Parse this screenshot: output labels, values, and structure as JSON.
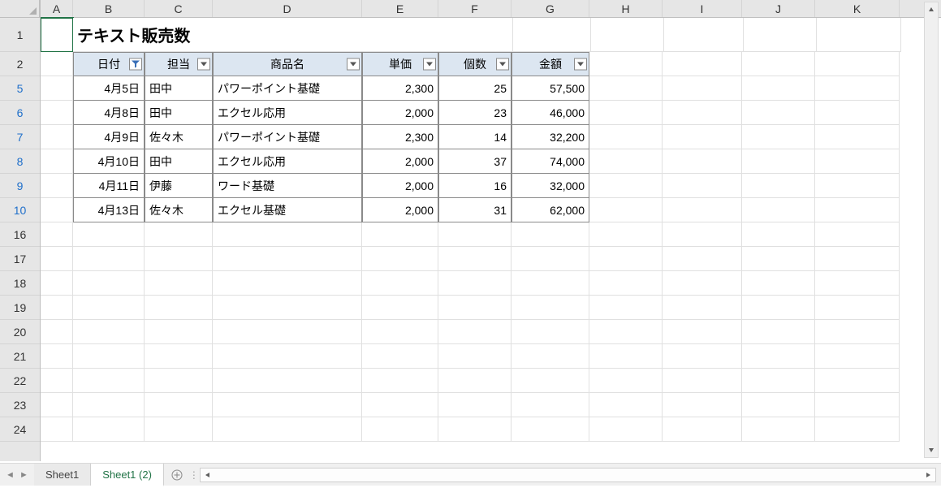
{
  "columns": [
    "A",
    "B",
    "C",
    "D",
    "E",
    "F",
    "G",
    "H",
    "I",
    "J",
    "K"
  ],
  "row_numbers_visible": [
    "1",
    "2",
    "5",
    "6",
    "7",
    "8",
    "9",
    "10",
    "16",
    "17",
    "18",
    "19",
    "20",
    "21",
    "22",
    "23",
    "24"
  ],
  "filtered_row_numbers": [
    "5",
    "6",
    "7",
    "8",
    "9",
    "10"
  ],
  "title": "テキスト販売数",
  "headers": {
    "date": "日付",
    "person": "担当",
    "product": "商品名",
    "unit_price": "単価",
    "qty": "個数",
    "amount": "金額"
  },
  "filter_state": {
    "date": "filtered"
  },
  "rows": [
    {
      "date": "4月5日",
      "person": "田中",
      "product": "パワーポイント基礎",
      "unit_price": "2,300",
      "qty": "25",
      "amount": "57,500"
    },
    {
      "date": "4月8日",
      "person": "田中",
      "product": "エクセル応用",
      "unit_price": "2,000",
      "qty": "23",
      "amount": "46,000"
    },
    {
      "date": "4月9日",
      "person": "佐々木",
      "product": "パワーポイント基礎",
      "unit_price": "2,300",
      "qty": "14",
      "amount": "32,200"
    },
    {
      "date": "4月10日",
      "person": "田中",
      "product": "エクセル応用",
      "unit_price": "2,000",
      "qty": "37",
      "amount": "74,000"
    },
    {
      "date": "4月11日",
      "person": "伊藤",
      "product": "ワード基礎",
      "unit_price": "2,000",
      "qty": "16",
      "amount": "32,000"
    },
    {
      "date": "4月13日",
      "person": "佐々木",
      "product": "エクセル基礎",
      "unit_price": "2,000",
      "qty": "31",
      "amount": "62,000"
    }
  ],
  "tabs": [
    {
      "label": "Sheet1",
      "active": false
    },
    {
      "label": "Sheet1 (2)",
      "active": true
    }
  ],
  "selected_cell": "A1",
  "chart_data": {
    "type": "table",
    "title": "テキスト販売数",
    "columns": [
      "日付",
      "担当",
      "商品名",
      "単価",
      "個数",
      "金額"
    ],
    "data": [
      [
        "4月5日",
        "田中",
        "パワーポイント基礎",
        2300,
        25,
        57500
      ],
      [
        "4月8日",
        "田中",
        "エクセル応用",
        2000,
        23,
        46000
      ],
      [
        "4月9日",
        "佐々木",
        "パワーポイント基礎",
        2300,
        14,
        32200
      ],
      [
        "4月10日",
        "田中",
        "エクセル応用",
        2000,
        37,
        74000
      ],
      [
        "4月11日",
        "伊藤",
        "ワード基礎",
        2000,
        16,
        32000
      ],
      [
        "4月13日",
        "佐々木",
        "エクセル基礎",
        2000,
        31,
        62000
      ]
    ]
  }
}
